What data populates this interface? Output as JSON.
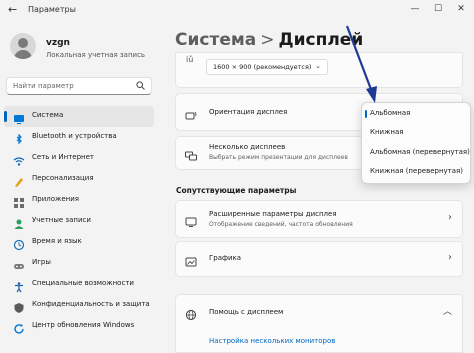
{
  "window": {
    "title": "Параметры",
    "back_glyph": "←",
    "controls": {
      "minimize": "—",
      "maximize": "☐",
      "close": "✕"
    }
  },
  "profile": {
    "name": "vzgn",
    "account_type": "Локальная учетная запись"
  },
  "search": {
    "placeholder": "Найти параметр",
    "icon": "search-icon"
  },
  "sidebar": {
    "items": [
      {
        "label": "Система",
        "icon": "system-icon",
        "icon_color": "#0078d4",
        "active": true
      },
      {
        "label": "Bluetooth и устройства",
        "icon": "bluetooth-icon",
        "icon_color": "#0078d4"
      },
      {
        "label": "Сеть и Интернет",
        "icon": "network-icon",
        "icon_color": "#0f6cbd"
      },
      {
        "label": "Персонализация",
        "icon": "personalization-icon",
        "icon_color": "#e3a21a"
      },
      {
        "label": "Приложения",
        "icon": "apps-icon",
        "icon_color": "#6b6b6b"
      },
      {
        "label": "Учетные записи",
        "icon": "accounts-icon",
        "icon_color": "#2e9e5b"
      },
      {
        "label": "Время и язык",
        "icon": "time-language-icon",
        "icon_color": "#1c6fb5"
      },
      {
        "label": "Игры",
        "icon": "gaming-icon",
        "icon_color": "#7a7a7a"
      },
      {
        "label": "Специальные возможности",
        "icon": "accessibility-icon",
        "icon_color": "#1b5fa8"
      },
      {
        "label": "Конфиденциальность и защита",
        "icon": "privacy-icon",
        "icon_color": "#5a5a5a"
      },
      {
        "label": "Центр обновления Windows",
        "icon": "windows-update-icon",
        "icon_color": "#0078d4"
      }
    ]
  },
  "breadcrumb": {
    "parent": "Система",
    "separator": ">",
    "current": "Дисплей"
  },
  "main": {
    "resolution": {
      "label_fragment": "iǔ",
      "value": "1600 × 900 (рекомендуется)"
    },
    "orientation": {
      "title": "Ориентация дисплея"
    },
    "multiple_displays": {
      "title": "Несколько дисплеев",
      "description": "Выбрать режим презентации для дисплеев"
    },
    "related_title": "Сопутствующие параметры",
    "advanced_display": {
      "title": "Расширенные параметры дисплея",
      "description": "Отображение сведений, частота обновления"
    },
    "graphics": {
      "title": "Графика"
    },
    "help": {
      "title": "Помощь с дисплеем",
      "link": "Настройка нескольких мониторов"
    }
  },
  "orientation_dropdown": {
    "options": [
      "Альбомная",
      "Книжная",
      "Альбомная (перевернутая)",
      "Книжная (перевернутая)"
    ],
    "selected": "Альбомная"
  },
  "colors": {
    "accent": "#0067c0",
    "annotation_arrow": "#1f3a93"
  }
}
